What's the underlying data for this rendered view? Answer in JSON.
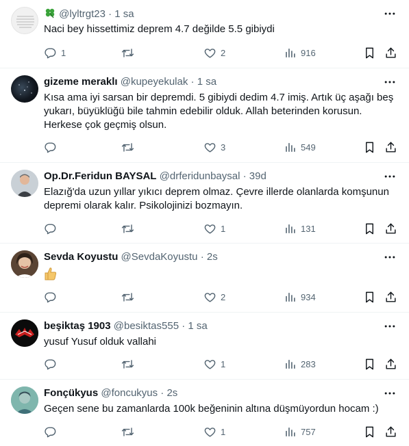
{
  "tweets": [
    {
      "name": "",
      "handle": "@lyltrgt23",
      "time": "1 sa",
      "text": "Naci bey hissettimiz deprem 4.7 değilde 5.5 gibiydi",
      "replies": "1",
      "retweets": "",
      "likes": "2",
      "views": "916",
      "name_emoji": "four-leaf-clover"
    },
    {
      "name": "gizeme meraklı",
      "handle": "@kupeyekulak",
      "time": "1 sa",
      "text": "Kısa ama iyi sarsan bir depremdi. 5 gibiydi dedim 4.7 imiş. Artık üç aşağı beş yukarı, büyüklüğü bile tahmin edebilir olduk. Allah beterinden korusun. Herkese çok geçmiş olsun.",
      "replies": "",
      "retweets": "",
      "likes": "3",
      "views": "549"
    },
    {
      "name": "Op.Dr.Feridun BAYSAL",
      "handle": "@drferidunbaysal",
      "time": "39d",
      "text": "Elazığ'da uzun yıllar yıkıcı deprem olmaz. Çevre illerde olanlarda komşunun depremi olarak kalır. Psikolojinizi bozmayın.",
      "replies": "",
      "retweets": "",
      "likes": "1",
      "views": "131"
    },
    {
      "name": "Sevda Koyustu",
      "handle": "@SevdaKoyustu",
      "time": "2s",
      "text": "",
      "replies": "",
      "retweets": "",
      "likes": "2",
      "views": "934",
      "body_emoji": "thumbs-up"
    },
    {
      "name": "beşiktaş 1903",
      "handle": "@besiktas555",
      "time": "1 sa",
      "text": "yusuf Yusuf olduk vallahi",
      "replies": "",
      "retweets": "",
      "likes": "1",
      "views": "283"
    },
    {
      "name": "Fonçükyus",
      "handle": "@foncukyus",
      "time": "2s",
      "text": "Geçen sene bu zamanlarda 100k beğeninin altına düşmüyordun hocam :)",
      "replies": "",
      "retweets": "",
      "likes": "1",
      "views": "757"
    }
  ],
  "ui": {
    "dot": "·",
    "text_color": "#0f1419",
    "muted_color": "#536471",
    "divider_color": "#eff3f4"
  }
}
